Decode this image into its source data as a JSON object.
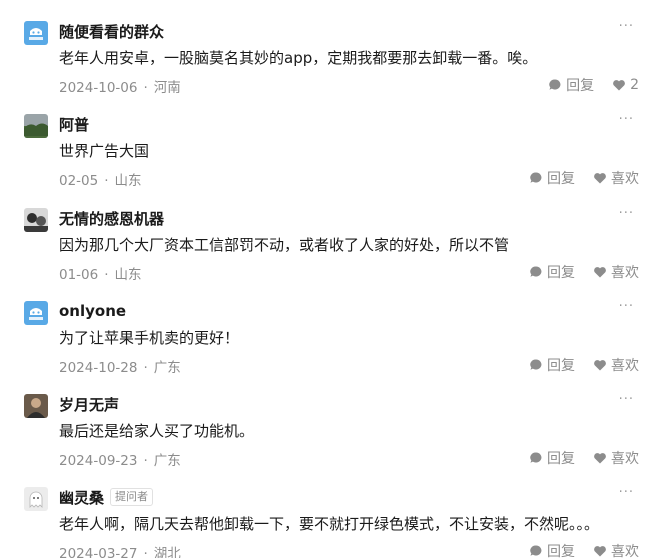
{
  "ui": {
    "reply_label": "回复",
    "like_label": "喜欢",
    "more_glyph": "···",
    "dot": "·",
    "asker_tag": "提问者"
  },
  "comments": [
    {
      "name": "随便看看的群众",
      "text": "老年人用安卓，一股脑莫名其妙的app，定期我都要那去卸载一番。唉。",
      "date": "2024-10-06",
      "location": "河南",
      "like_text": "2",
      "avatar": "bot-avatar-icon"
    },
    {
      "name": "阿普",
      "text": "世界广告大国",
      "date": "02-05",
      "location": "山东",
      "like_text": "喜欢",
      "avatar": "landscape-avatar"
    },
    {
      "name": "无情的感恩机器",
      "text": "因为那几个大厂资本工信部罚不动，或者收了人家的好处，所以不管",
      "date": "01-06",
      "location": "山东",
      "like_text": "喜欢",
      "avatar": "photo-avatar"
    },
    {
      "name": "onlyone",
      "text": "为了让苹果手机卖的更好！",
      "date": "2024-10-28",
      "location": "广东",
      "like_text": "喜欢",
      "avatar": "bot-avatar-icon"
    },
    {
      "name": "岁月无声",
      "text": "最后还是给家人买了功能机。",
      "date": "2024-09-23",
      "location": "广东",
      "like_text": "喜欢",
      "avatar": "portrait-avatar"
    },
    {
      "name": "幽灵桑",
      "text": "老年人啊，隔几天去帮他卸载一下，要不就打开绿色模式，不让安装，不然呢。。。",
      "date": "2024-03-27",
      "location": "湖北",
      "like_text": "喜欢",
      "avatar": "ghost-avatar",
      "is_asker": true
    }
  ]
}
